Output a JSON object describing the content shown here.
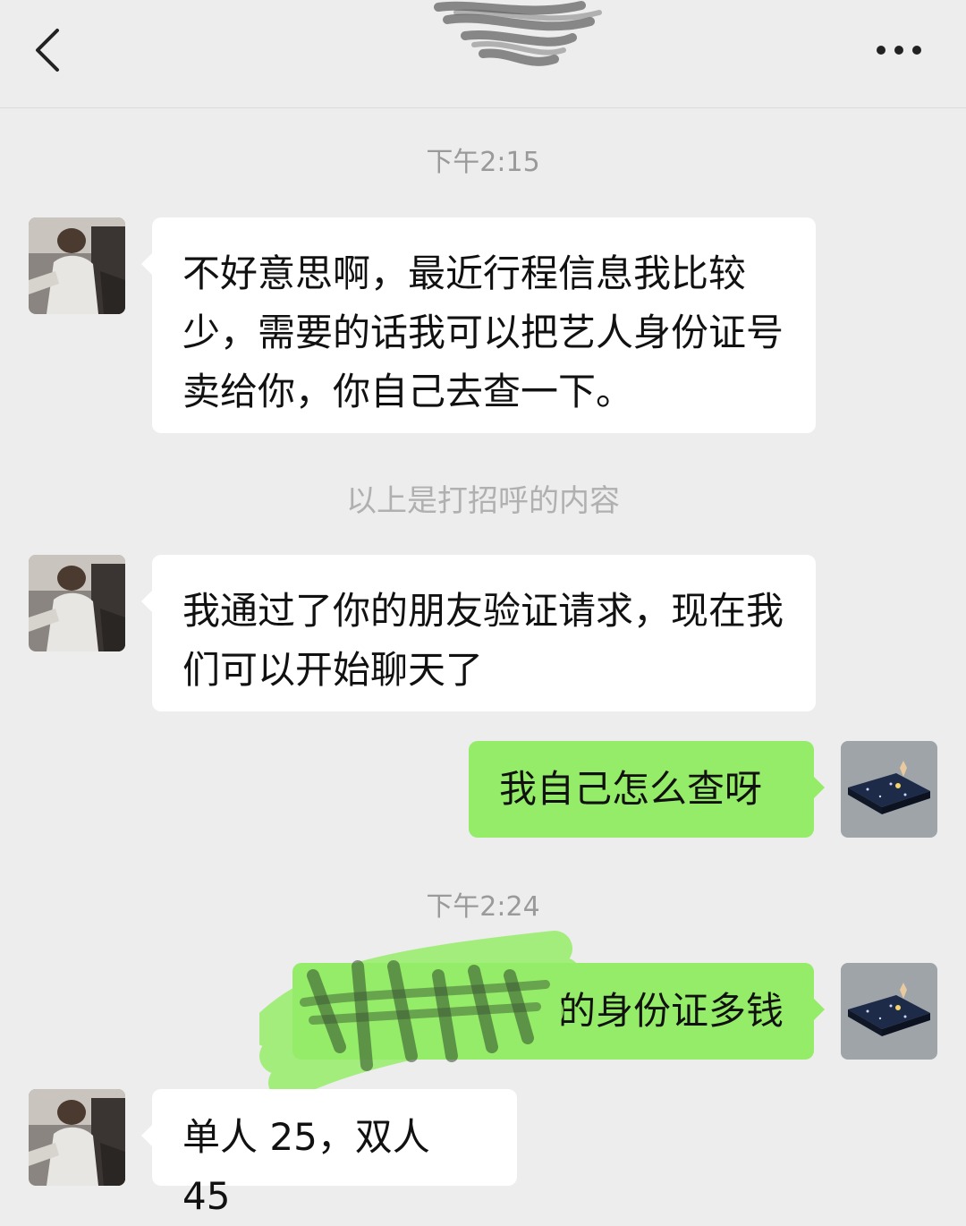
{
  "header": {
    "back_icon": "chevron-left-icon",
    "more_icon": "more-horizontal-icon"
  },
  "messages": {
    "time1": "下午2:15",
    "msg1": "不好意思啊，最近行程信息我比较少，需要的话我可以把艺人身份证号卖给你，你自己去查一下。",
    "note": "以上是打招呼的内容",
    "msg2": "我通过了你的朋友验证请求，现在我们可以开始聊天了",
    "msg3": "我自己怎么查呀",
    "time2": "下午2:24",
    "msg4": "的身份证多钱",
    "msg5": "单人 25，双人 45"
  },
  "colors": {
    "background": "#ededed",
    "bubble_self": "#95ec69",
    "bubble_other": "#ffffff",
    "timestamp": "#9a9a9a"
  }
}
